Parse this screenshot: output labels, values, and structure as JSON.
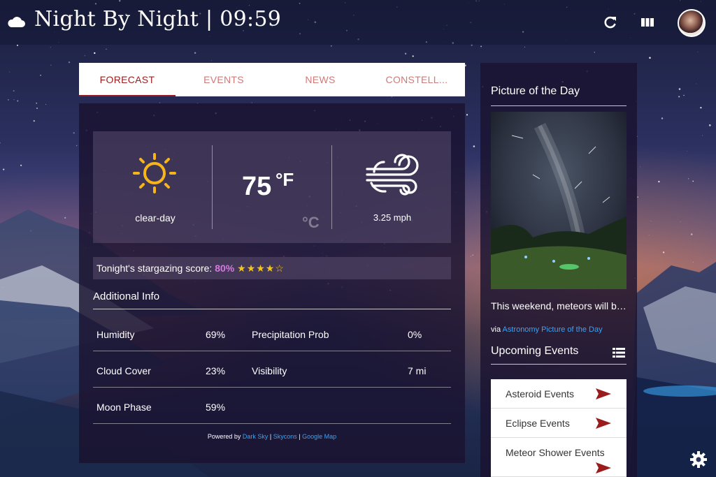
{
  "header": {
    "title": "Night By Night | 09:59",
    "refresh_icon": "refresh-icon",
    "layout_icon": "columns-icon"
  },
  "tabs": [
    {
      "label": "FORECAST",
      "active": true
    },
    {
      "label": "EVENTS",
      "active": false
    },
    {
      "label": "NEWS",
      "active": false
    },
    {
      "label": "CONSTELL...",
      "active": false
    }
  ],
  "forecast": {
    "condition": "clear-day",
    "temperature": "75",
    "unit": "°F",
    "alt_unit": "°C",
    "wind": "3.25 mph",
    "score_label": "Tonight's stargazing score:",
    "score_value": "80%",
    "stars_filled": 4,
    "stars_total": 5,
    "additional_title": "Additional Info",
    "info": {
      "humidity_label": "Humidity",
      "humidity_value": "69%",
      "precip_label": "Precipitation Prob",
      "precip_value": "0%",
      "cloud_label": "Cloud Cover",
      "cloud_value": "23%",
      "visibility_label": "Visibility",
      "visibility_value": "7 mi",
      "moon_label": "Moon Phase",
      "moon_value": "59%"
    },
    "powered_by": "Powered by",
    "credits": [
      "Dark Sky",
      "Skycons",
      "Google Map"
    ],
    "separator": "|"
  },
  "sidebar": {
    "potd_title": "Picture of the Day",
    "potd_caption": "This weekend, meteors will be streaking across the sky",
    "via_label": "via",
    "via_link": "Astronomy Picture of the Day",
    "events_title": "Upcoming Events",
    "events": [
      {
        "label": "Asteroid Events"
      },
      {
        "label": "Eclipse Events"
      },
      {
        "label": "Meteor Shower Events"
      }
    ]
  },
  "colors": {
    "accent": "#9b1c1c",
    "tab_inactive": "#d07a78",
    "link": "#3aa3f5",
    "score": "#d37adf",
    "star": "#f5c516",
    "sun": "#f7b51a"
  }
}
